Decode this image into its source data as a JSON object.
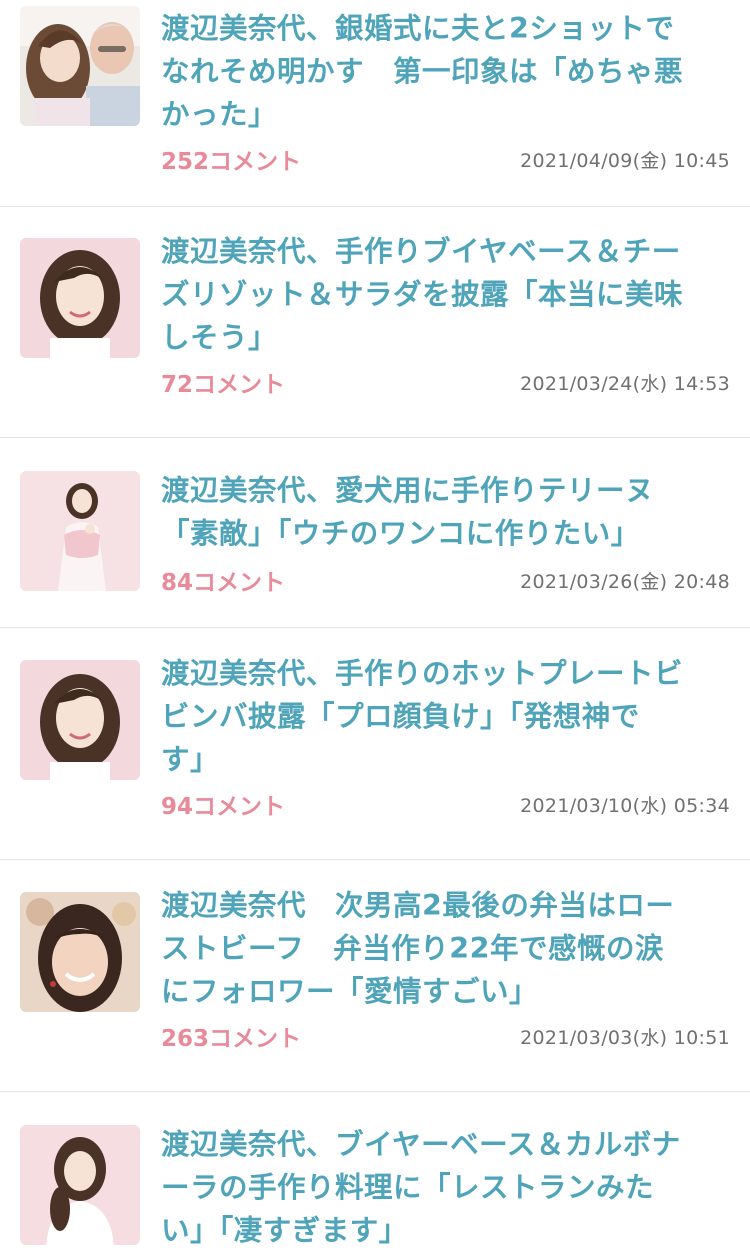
{
  "articles": [
    {
      "title_lines": [
        "渡辺美奈代、銀婚式に夫と2ショットで",
        "なれそめ明かす　第一印象は「めちゃ悪",
        "かった」"
      ],
      "comments": "252コメント",
      "date": "2021/04/09(金) 10:45",
      "thumb": "couple-photo"
    },
    {
      "title_lines": [
        "渡辺美奈代、手作りブイヤベース＆チー",
        "ズリゾット＆サラダを披露「本当に美味",
        "しそう」"
      ],
      "comments": "72コメント",
      "date": "2021/03/24(水) 14:53",
      "thumb": "portrait-photo"
    },
    {
      "title_lines": [
        "渡辺美奈代、愛犬用に手作りテリーヌ",
        "「素敵」「ウチのワンコに作りたい」"
      ],
      "comments": "84コメント",
      "date": "2021/03/26(金) 20:48",
      "thumb": "fullbody-photo"
    },
    {
      "title_lines": [
        "渡辺美奈代、手作りのホットプレートビ",
        "ビンバ披露「プロ顔負け」「発想神で",
        "す」"
      ],
      "comments": "94コメント",
      "date": "2021/03/10(水) 05:34",
      "thumb": "portrait-photo"
    },
    {
      "title_lines": [
        "渡辺美奈代　次男高2最後の弁当はロー",
        "ストビーフ　弁当作り22年で感慨の涙",
        "にフォロワー「愛情すごい」"
      ],
      "comments": "263コメント",
      "date": "2021/03/03(水) 10:51",
      "thumb": "closeup-photo"
    },
    {
      "title_lines": [
        "渡辺美奈代、ブイヤーベース＆カルボナ",
        "ーラの手作り料理に「レストランみた",
        "い」「凄すぎます」"
      ],
      "comments": "",
      "date": "",
      "thumb": "upper-body-photo"
    }
  ],
  "colors": {
    "title": "#4fa4ba",
    "comments": "#e88a9a",
    "date": "#707070",
    "divider": "#e6e6e6"
  }
}
